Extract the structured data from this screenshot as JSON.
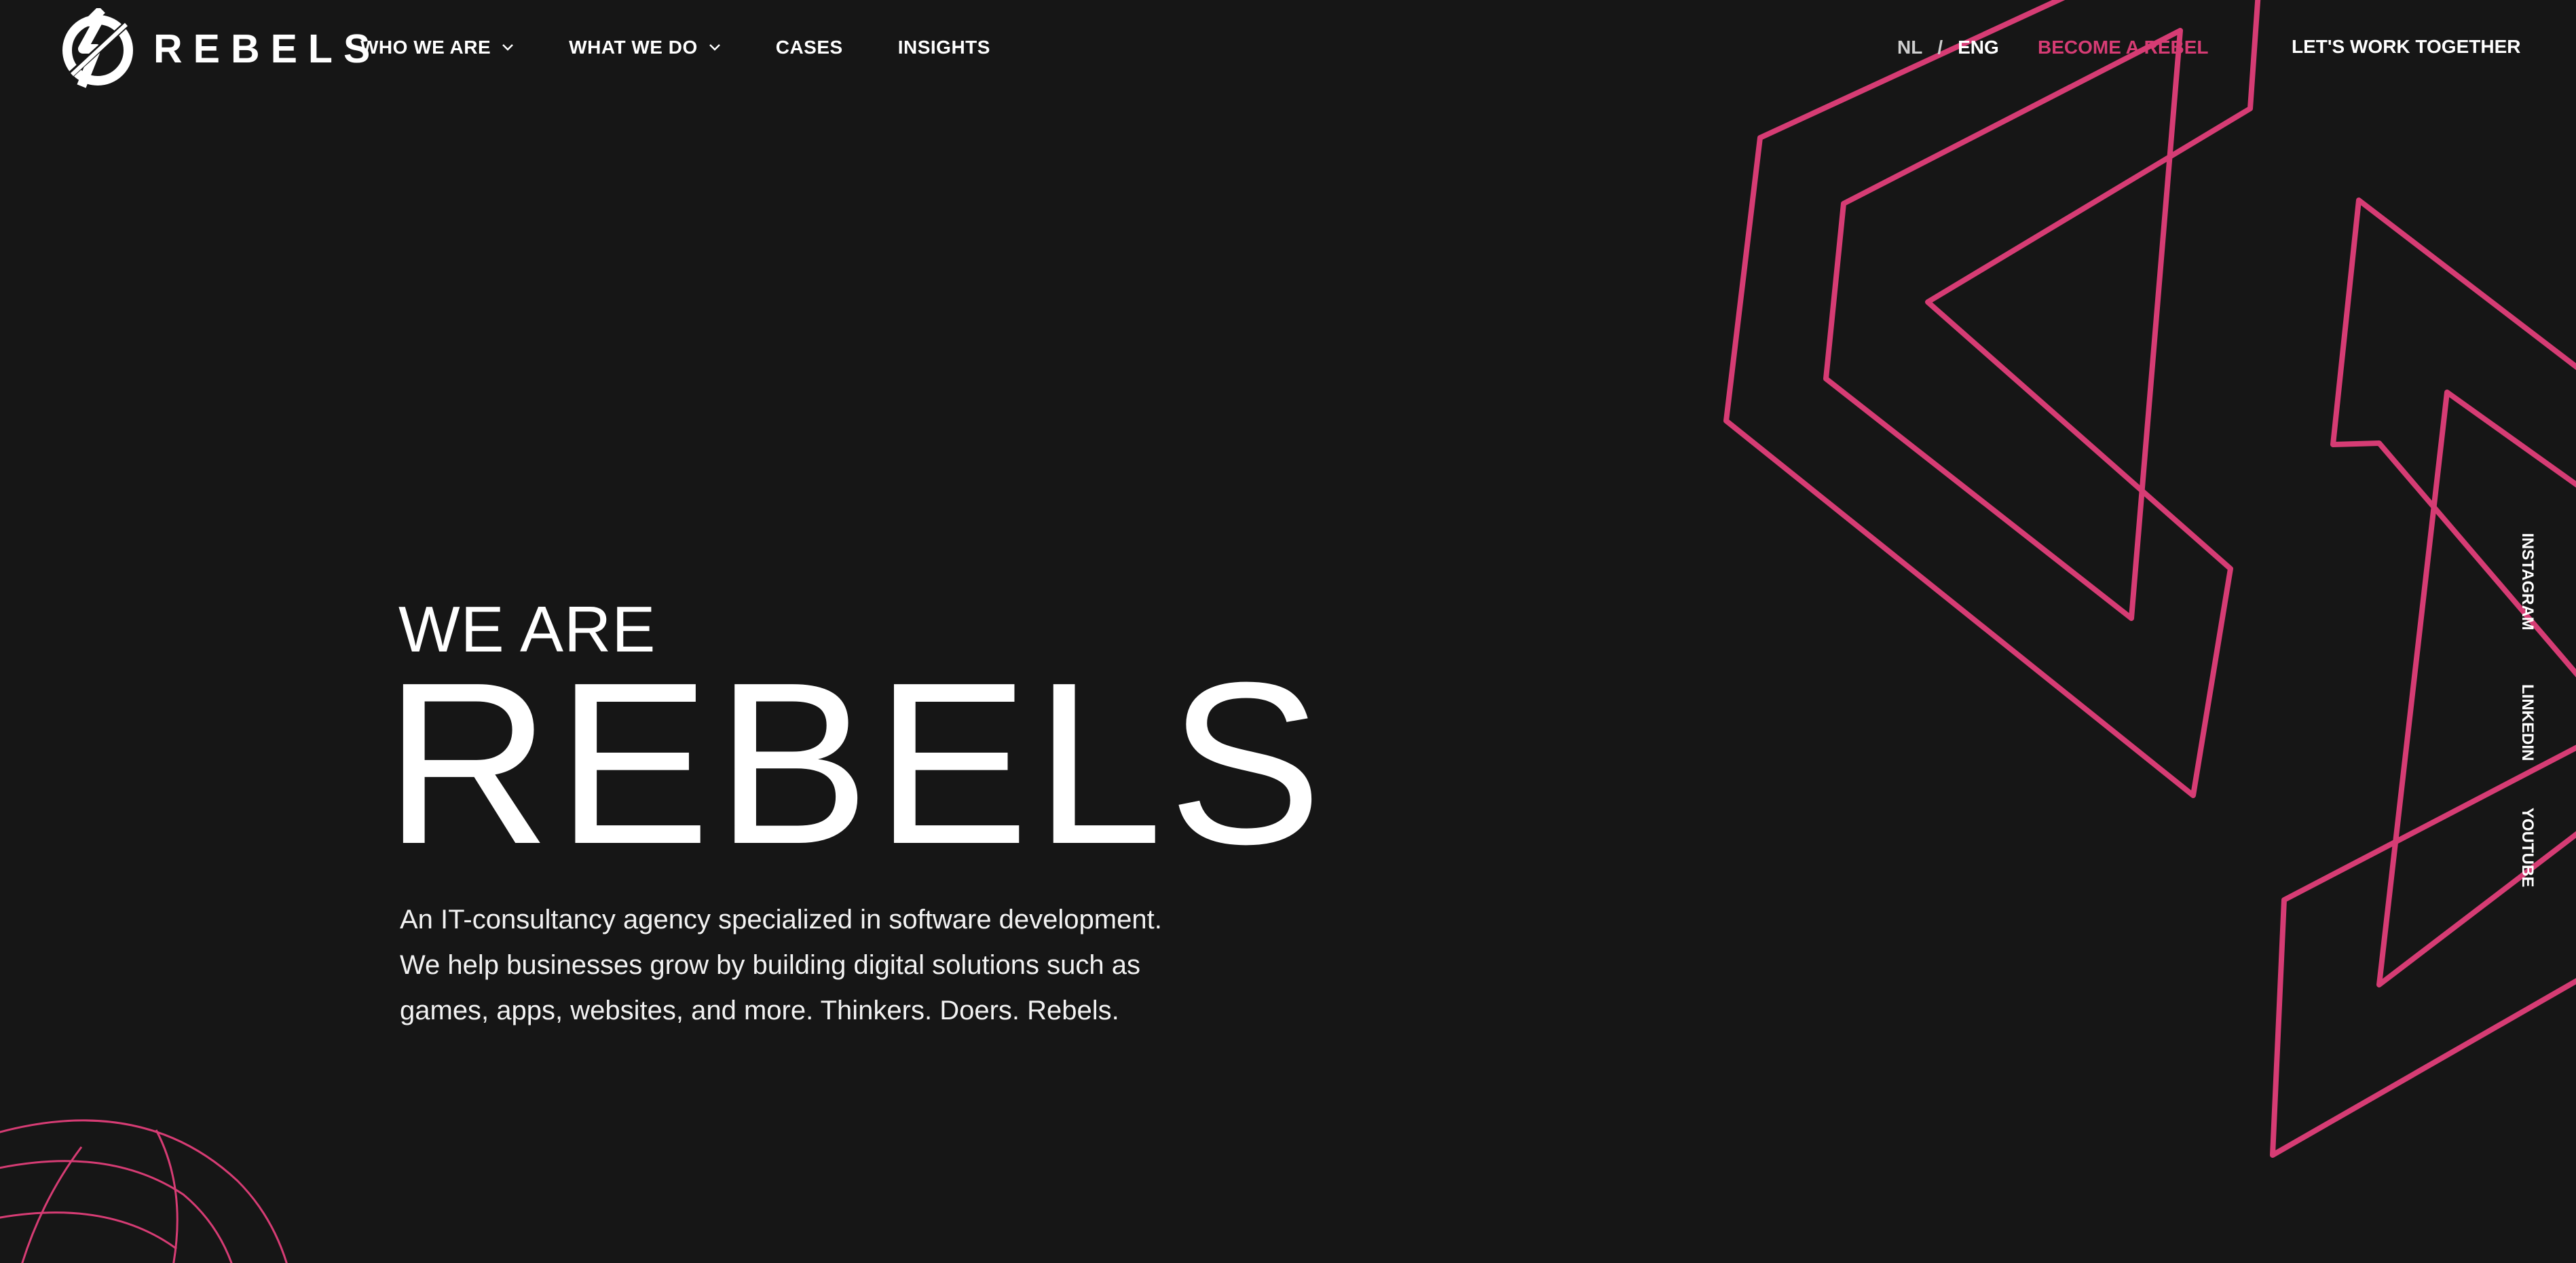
{
  "brand": {
    "name": "REBELS",
    "accent_color": "#d63c74",
    "background_color": "#161616"
  },
  "nav": {
    "items": [
      {
        "label": "WHO WE ARE",
        "has_dropdown": true,
        "icon": "chevron-down-icon"
      },
      {
        "label": "WHAT WE DO",
        "has_dropdown": true,
        "icon": "chevron-down-icon"
      },
      {
        "label": "CASES",
        "has_dropdown": false
      },
      {
        "label": "INSIGHTS",
        "has_dropdown": false
      }
    ]
  },
  "header": {
    "lang_nl": "NL",
    "lang_separator": "/",
    "lang_eng": "ENG",
    "become_rebel": "BECOME A REBEL",
    "cta": "LET'S WORK TOGETHER"
  },
  "hero": {
    "pre_title": "WE ARE",
    "title": "REBELS",
    "description": "An IT-consultancy agency specialized in software development. We help businesses grow by building digital solutions such as games, apps, websites, and more. Thinkers. Doers. Rebels."
  },
  "social": {
    "instagram": "INSTAGRAM",
    "linkedin": "LINKEDIN",
    "youtube": "YOUTUBE"
  }
}
